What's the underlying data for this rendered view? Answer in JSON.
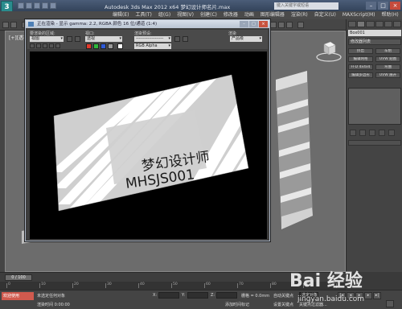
{
  "title_bar": {
    "logo": "3",
    "window_title": "Autodesk 3ds Max  2012 x64     梦幻设计师名片.max",
    "search_placeholder": "键入关键字或短语"
  },
  "menubar": {
    "items": [
      "编辑(E)",
      "工具(T)",
      "组(G)",
      "视图(V)",
      "创建(C)",
      "修改器",
      "动画",
      "图形编辑器",
      "渲染(R)",
      "自定义(U)",
      "MAXScript(M)",
      "帮助(H)"
    ]
  },
  "viewport": {
    "label": "[+][透视][真实]"
  },
  "render_window": {
    "title": "正在渲染 - 显示 gamma: 2.2, RGBA 颜色 16 位/通道 (1:4)",
    "area_label": "要渲染的区域:",
    "area_value": "视图",
    "viewport_label": "视口:",
    "viewport_value": "透视",
    "preset_label": "渲染预设:",
    "preset_value": "-------------------",
    "render_button": "渲染",
    "production_value": "产品级",
    "channel_value": "RGB Alpha",
    "colors": {
      "red": "#e23a2c",
      "green": "#2fb83b",
      "blue": "#2f5bd6",
      "gray": "#9a9a9a"
    }
  },
  "card": {
    "line1": "梦幻设计师",
    "line2": "MHSJS001"
  },
  "command_panel": {
    "object_name": "Box001",
    "modifier_list": "修改器列表",
    "buttons": [
      "挤出",
      "车削",
      "编辑网格",
      "UVW 贴图",
      "FFD 4x4x4",
      "弯曲",
      "编辑多边形",
      "UVW 展开"
    ]
  },
  "timeline": {
    "frame": "0 / 100",
    "ticks": [
      "0",
      "10",
      "20",
      "30",
      "40",
      "50",
      "60",
      "70",
      "80",
      "90",
      "100"
    ]
  },
  "status": {
    "prompt_red": "欢迎使用",
    "selected": "未选定任何对象",
    "hint": "渲染时间 0:00:00",
    "x_label": "X:",
    "y_label": "Y:",
    "z_label": "Z:",
    "grid": "栅格 = 0.0mm",
    "auto_key": "自动关键点",
    "set_key": "设置关键点",
    "selected_obj": "选定对象",
    "add_time": "添加时间标记",
    "key_filter": "关键点过滤器..."
  },
  "watermark": {
    "text": "Bai 经验",
    "url": "jingyan.baidu.com"
  }
}
